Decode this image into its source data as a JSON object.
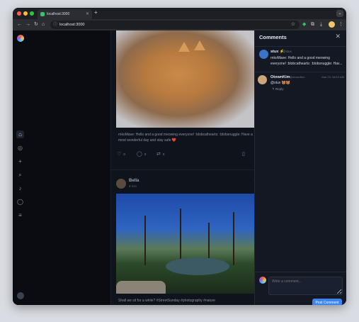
{
  "browser": {
    "tab_title": "localhost:3000",
    "new_tab": "+",
    "url": "localhost:3000"
  },
  "feed": {
    "post1": {
      "caption": "rnkoMave: Hello and a good meowing everyone! :blobcathearts: :blobsnuggle: Have a most wonderful day and stay safe ❤️",
      "counts": {
        "replies": "0",
        "boosts": "0",
        "reposts": "0"
      }
    },
    "post2": {
      "author": "Bella",
      "handle": "8 min",
      "caption": "Shall we sit for a while? #StreetSunday #photography #nature"
    }
  },
  "comments": {
    "title": "Comments",
    "main": {
      "name": "stux ⚡",
      "handle": "@stux",
      "text": "rnkoMave: Hello and a good meowing everyone! :blobcathearts: :blobsnuggle: Hav..."
    },
    "reply": {
      "name": "OtownKim",
      "handle": "@otownKim",
      "time": "Mar 23, 08:10 AM",
      "text": "@stux 😻😻",
      "reply_label": "Reply"
    },
    "composer": {
      "placeholder": "Write a comment...",
      "submit": "Post Comment"
    }
  },
  "colors": {
    "accent": "#3a85f3",
    "panel_bg": "#131823",
    "feed_bg": "#0f131b"
  }
}
